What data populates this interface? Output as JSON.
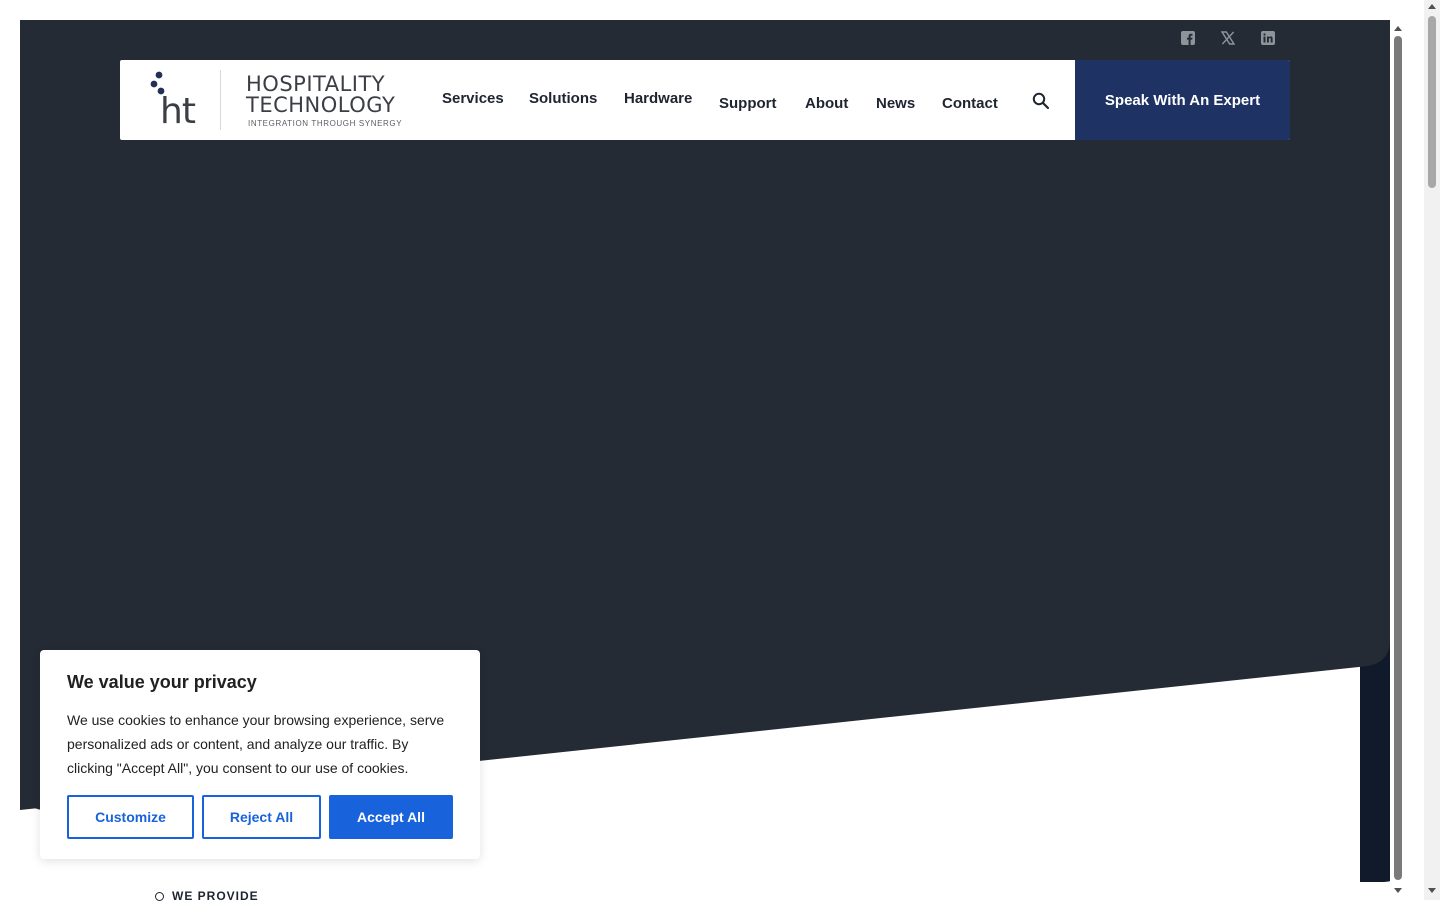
{
  "brand": {
    "logo_mark": "ht",
    "name_line1": "HOSPITALITY",
    "name_line2": "TECHNOLOGY",
    "tagline": "INTEGRATION THROUGH SYNERGY",
    "navy": "#1f3264",
    "dark": "#252b34"
  },
  "social": {
    "icons": [
      "facebook-icon",
      "x-icon",
      "linkedin-icon"
    ]
  },
  "nav": {
    "items": [
      "Services",
      "Solutions",
      "Hardware",
      "Support",
      "About",
      "News",
      "Contact"
    ],
    "search_icon": "search-icon",
    "cta_label": "Speak With An Expert"
  },
  "section": {
    "eyebrow": "WE PROVIDE"
  },
  "cookie": {
    "title": "We value your privacy",
    "body": "We use cookies to enhance your browsing experience, serve personalized ads or content, and analyze our traffic. By clicking \"Accept All\", you consent to our use of cookies.",
    "customize_label": "Customize",
    "reject_label": "Reject All",
    "accept_label": "Accept All",
    "accent": "#1863dc"
  }
}
